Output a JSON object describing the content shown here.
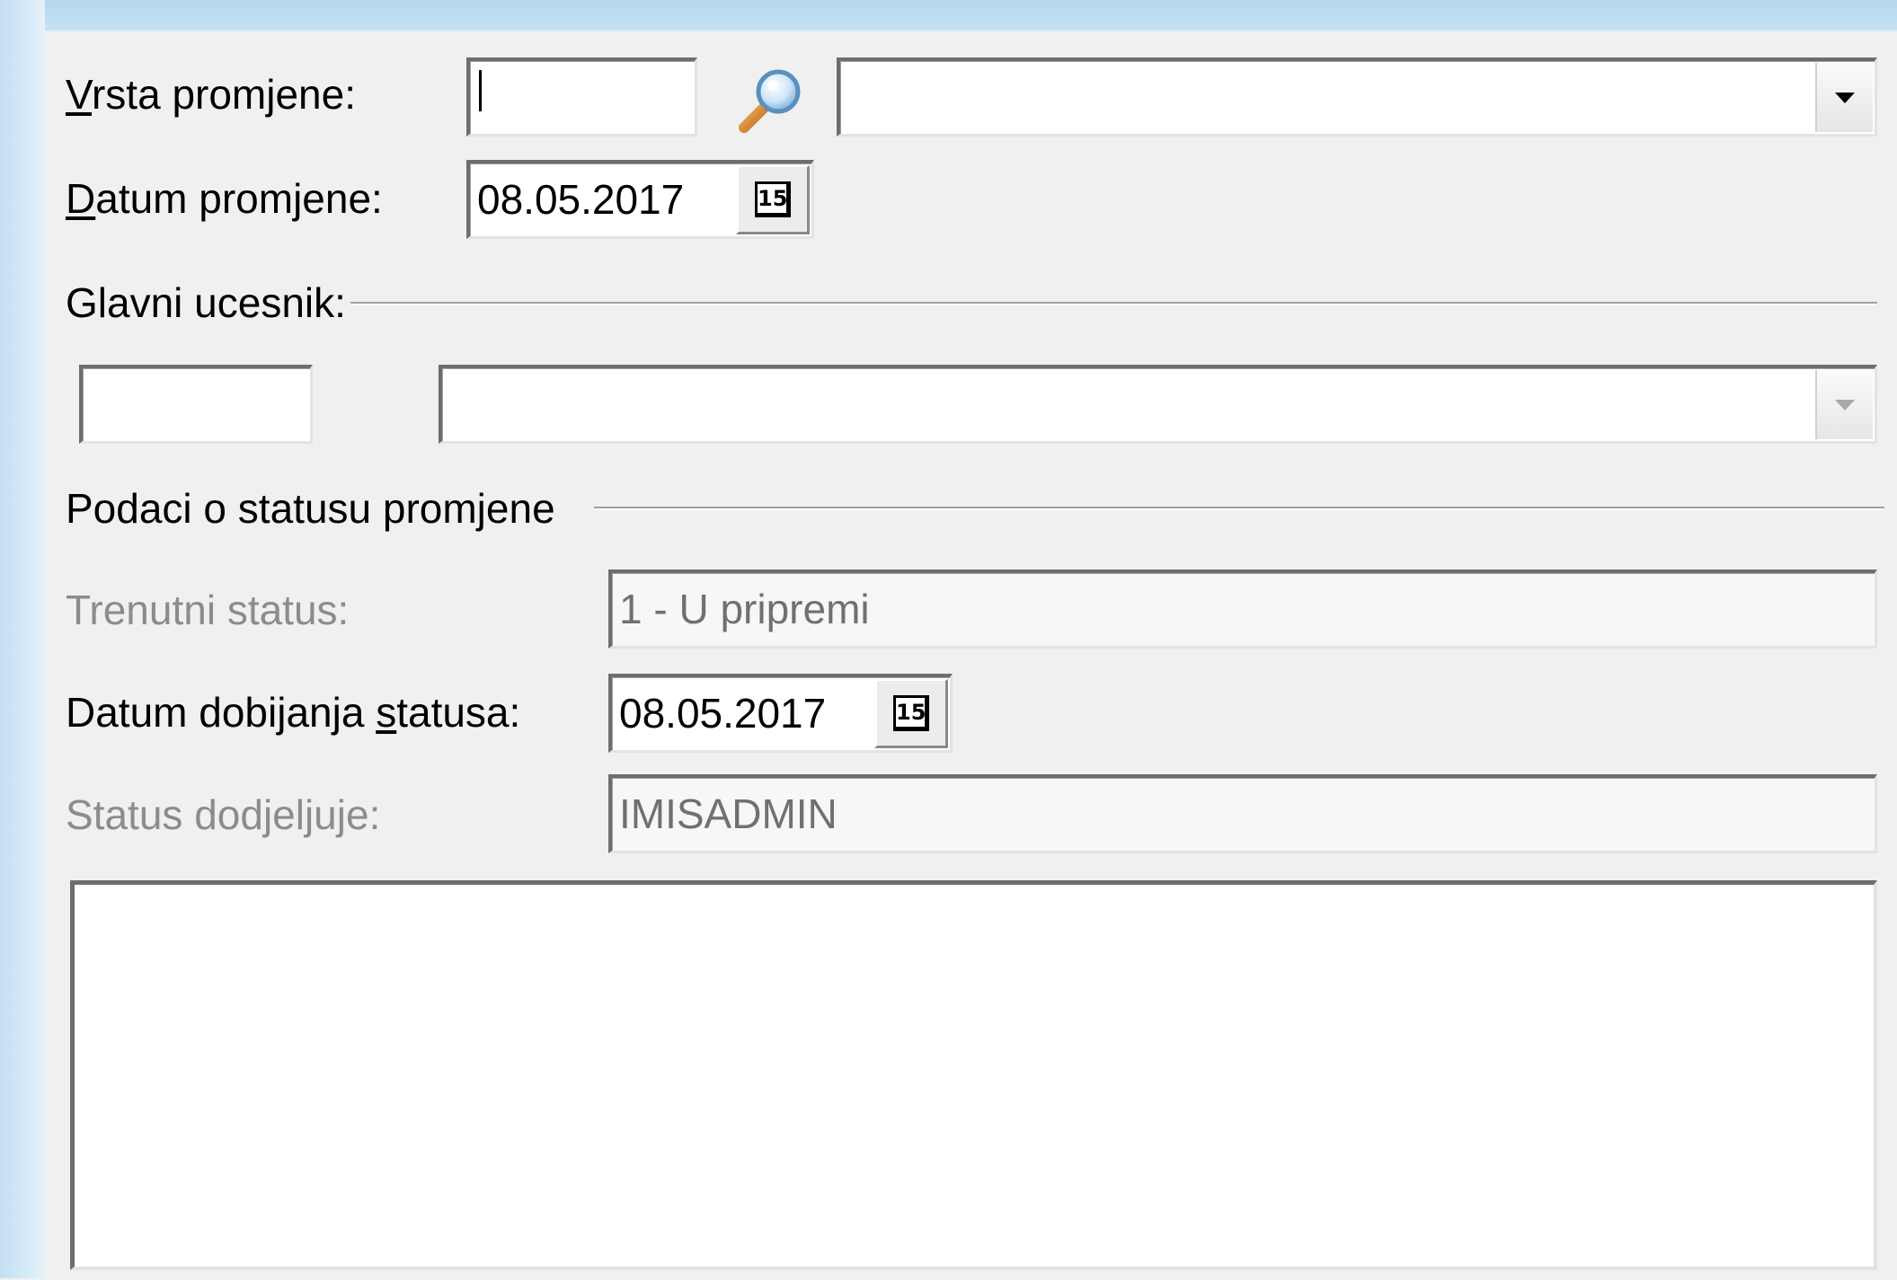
{
  "form": {
    "vrsta_promjene": {
      "label_prefix": "V",
      "label_rest": "rsta promjene:",
      "code_value": "",
      "select_value": ""
    },
    "datum_promjene": {
      "label_prefix": "D",
      "label_rest": "atum promjene:",
      "value": "08.05.2017",
      "calendar_day": "15"
    },
    "glavni_ucesnik": {
      "group_label": "Glavni ucesnik:",
      "code_value": "",
      "select_value": ""
    },
    "status_group": {
      "group_label": "Podaci o statusu promjene",
      "trenutni_status": {
        "label": "Trenutni status:",
        "value": "1 - U pripremi"
      },
      "datum_dobijanja": {
        "label_before": "Datum dobijanja ",
        "label_accel": "s",
        "label_after": "tatusa:",
        "value": "08.05.2017",
        "calendar_day": "15"
      },
      "status_dodjeljuje": {
        "label": "Status dodjeljuje:",
        "value": "IMISADMIN"
      }
    },
    "memo": {
      "value": ""
    }
  },
  "icons": {
    "search": "magnifier-icon",
    "calendar": "calendar-icon",
    "dropdown": "chevron-down-icon"
  },
  "colors": {
    "window_frame": "#c3dff2",
    "panel_background": "#f0f0f0",
    "disabled_text": "#8c8c8c"
  }
}
